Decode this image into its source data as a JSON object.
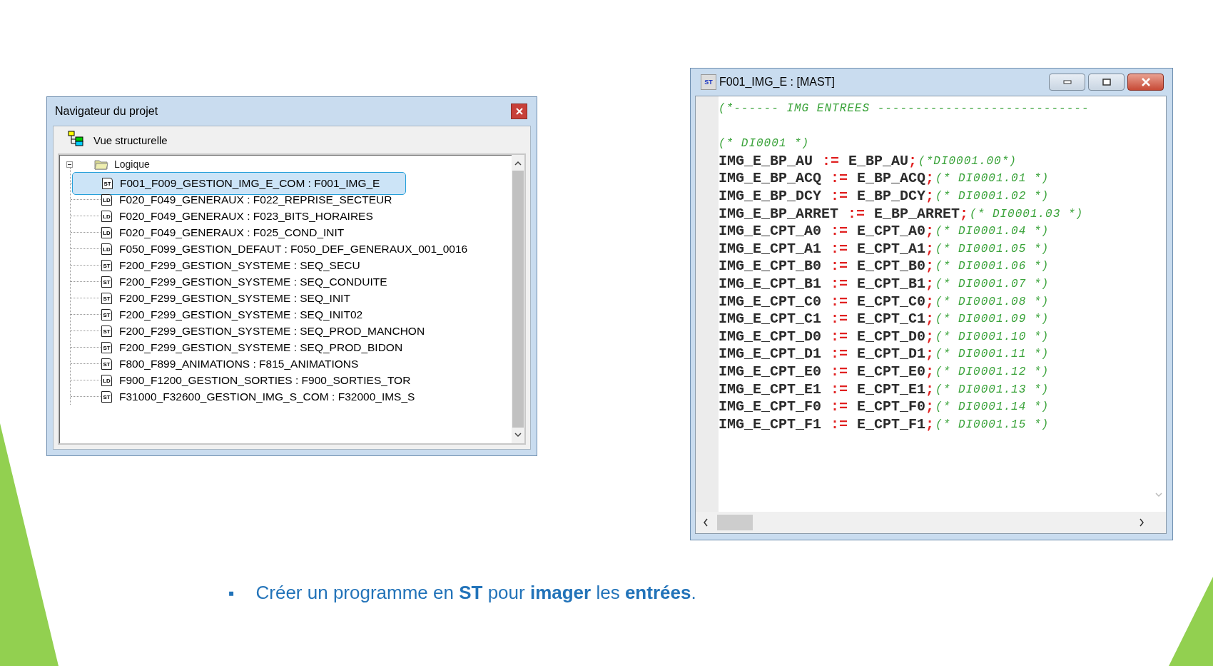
{
  "navigator": {
    "title": "Navigateur du projet",
    "toolbar_label": "Vue structurelle",
    "tree": {
      "label": "Logique",
      "expanded": true,
      "children": [
        {
          "label": "F001_F009_GESTION_IMG_E_COM : F001_IMG_E",
          "kind": "ST",
          "selected": true
        },
        {
          "label": "F020_F049_GENERAUX : F022_REPRISE_SECTEUR",
          "kind": "LD",
          "selected": false
        },
        {
          "label": "F020_F049_GENERAUX : F023_BITS_HORAIRES",
          "kind": "LD",
          "selected": false
        },
        {
          "label": "F020_F049_GENERAUX : F025_COND_INIT",
          "kind": "LD",
          "selected": false
        },
        {
          "label": "F050_F099_GESTION_DEFAUT : F050_DEF_GENERAUX_001_0016",
          "kind": "LD",
          "selected": false
        },
        {
          "label": "F200_F299_GESTION_SYSTEME : SEQ_SECU",
          "kind": "ST",
          "selected": false
        },
        {
          "label": "F200_F299_GESTION_SYSTEME : SEQ_CONDUITE",
          "kind": "ST",
          "selected": false
        },
        {
          "label": "F200_F299_GESTION_SYSTEME : SEQ_INIT",
          "kind": "ST",
          "selected": false
        },
        {
          "label": "F200_F299_GESTION_SYSTEME : SEQ_INIT02",
          "kind": "ST",
          "selected": false
        },
        {
          "label": "F200_F299_GESTION_SYSTEME : SEQ_PROD_MANCHON",
          "kind": "ST",
          "selected": false
        },
        {
          "label": "F200_F299_GESTION_SYSTEME : SEQ_PROD_BIDON",
          "kind": "ST",
          "selected": false
        },
        {
          "label": "F800_F899_ANIMATIONS : F815_ANIMATIONS",
          "kind": "ST",
          "selected": false
        },
        {
          "label": "F900_F1200_GESTION_SORTIES : F900_SORTIES_TOR",
          "kind": "LD",
          "selected": false
        },
        {
          "label": "F31000_F32600_GESTION_IMG_S_COM : F32000_IMS_S",
          "kind": "ST",
          "selected": false
        }
      ]
    }
  },
  "editor": {
    "title": "F001_IMG_E : [MAST]",
    "title_icon": "ST",
    "lines": [
      {
        "kind": "comment",
        "text": "(*------ IMG ENTREES ----------------------------"
      },
      {
        "kind": "blank"
      },
      {
        "kind": "comment",
        "text": "(* DI0001 *)"
      },
      {
        "kind": "assign",
        "target": "IMG_E_BP_AU",
        "op": ":=",
        "source": "E_BP_AU",
        "end": ";",
        "comment": "(*DI0001.00*)"
      },
      {
        "kind": "assign",
        "target": "IMG_E_BP_ACQ",
        "op": ":=",
        "source": "E_BP_ACQ",
        "end": ";",
        "comment": "(* DI0001.01 *)"
      },
      {
        "kind": "assign",
        "target": "IMG_E_BP_DCY",
        "op": ":=",
        "source": "E_BP_DCY",
        "end": ";",
        "comment": "(* DI0001.02 *)"
      },
      {
        "kind": "assign",
        "target": "IMG_E_BP_ARRET",
        "op": ":=",
        "source": "E_BP_ARRET",
        "end": ";",
        "comment": "(* DI0001.03 *)"
      },
      {
        "kind": "assign",
        "target": "IMG_E_CPT_A0",
        "op": ":=",
        "source": "E_CPT_A0",
        "end": ";",
        "comment": "(* DI0001.04 *)"
      },
      {
        "kind": "assign",
        "target": "IMG_E_CPT_A1",
        "op": ":=",
        "source": "E_CPT_A1",
        "end": ";",
        "comment": "(* DI0001.05 *)"
      },
      {
        "kind": "assign",
        "target": "IMG_E_CPT_B0",
        "op": ":=",
        "source": "E_CPT_B0",
        "end": ";",
        "comment": "(* DI0001.06 *)"
      },
      {
        "kind": "assign",
        "target": "IMG_E_CPT_B1",
        "op": ":=",
        "source": "E_CPT_B1",
        "end": ";",
        "comment": "(* DI0001.07 *)"
      },
      {
        "kind": "assign",
        "target": "IMG_E_CPT_C0",
        "op": ":=",
        "source": "E_CPT_C0",
        "end": ";",
        "comment": "(* DI0001.08 *)"
      },
      {
        "kind": "assign",
        "target": "IMG_E_CPT_C1",
        "op": ":=",
        "source": "E_CPT_C1",
        "end": ";",
        "comment": "(* DI0001.09 *)"
      },
      {
        "kind": "assign",
        "target": "IMG_E_CPT_D0",
        "op": ":=",
        "source": "E_CPT_D0",
        "end": ";",
        "comment": "(* DI0001.10 *)"
      },
      {
        "kind": "assign",
        "target": "IMG_E_CPT_D1",
        "op": ":=",
        "source": "E_CPT_D1",
        "end": ";",
        "comment": "(* DI0001.11 *)"
      },
      {
        "kind": "assign",
        "target": "IMG_E_CPT_E0",
        "op": ":=",
        "source": "E_CPT_E0",
        "end": ";",
        "comment": "(* DI0001.12 *)"
      },
      {
        "kind": "assign",
        "target": "IMG_E_CPT_E1",
        "op": ":=",
        "source": "E_CPT_E1",
        "end": ";",
        "comment": "(* DI0001.13 *)"
      },
      {
        "kind": "assign",
        "target": "IMG_E_CPT_F0",
        "op": ":=",
        "source": "E_CPT_F0",
        "end": ";",
        "comment": "(* DI0001.14 *)"
      },
      {
        "kind": "assign",
        "target": "IMG_E_CPT_F1",
        "op": ":=",
        "source": "E_CPT_F1",
        "end": ";",
        "comment": "(* DI0001.15 *)"
      }
    ]
  },
  "caption": {
    "bullet": "▪",
    "text": "Créer un programme en **ST** pour **imager** les **entrées**."
  }
}
